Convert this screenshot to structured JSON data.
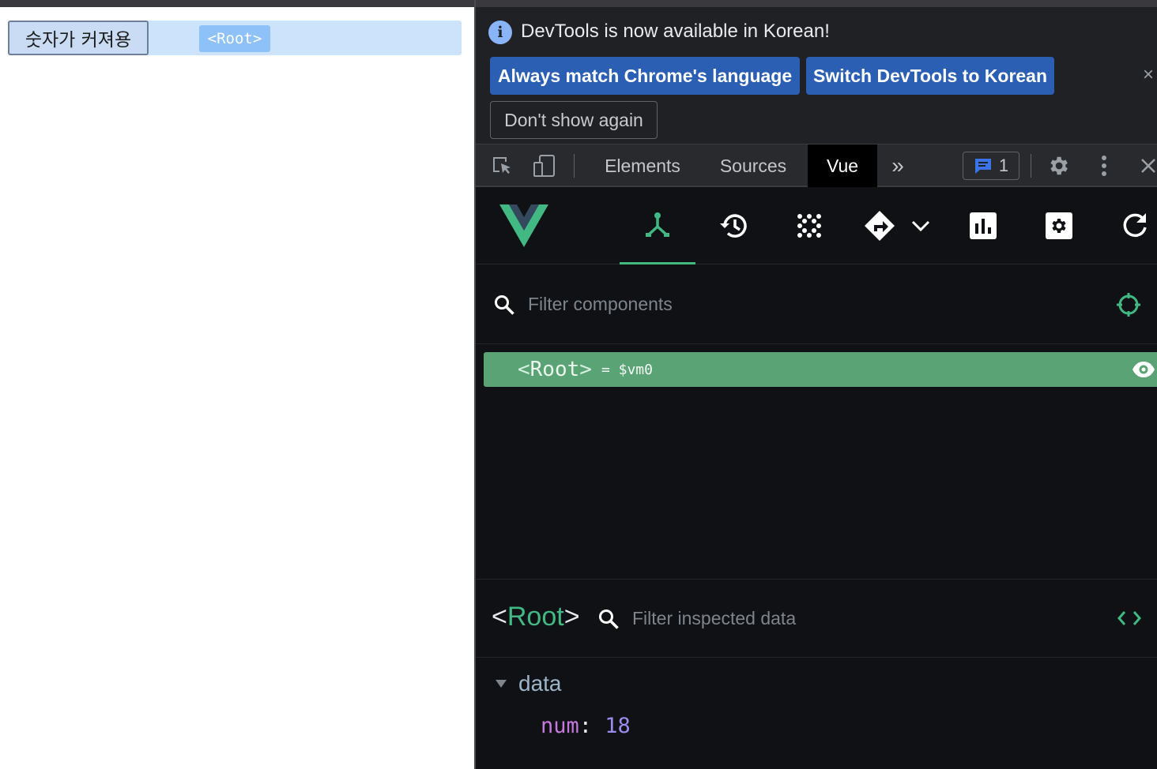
{
  "page": {
    "button_label": "숫자가 커져용",
    "root_tag": "<Root>"
  },
  "infobar": {
    "message": "DevTools is now available in Korean!",
    "always_match": "Always match Chrome's language",
    "switch_label": "Switch DevTools to Korean",
    "dont_show": "Don't show again",
    "close": "×"
  },
  "toolbar": {
    "tabs": [
      "Elements",
      "Sources",
      "Vue"
    ],
    "active_tab": "Vue",
    "more": "»",
    "issues_count": "1"
  },
  "vue": {
    "nav": [
      "components-icon",
      "timeline-icon",
      "plugins-icon",
      "routes-icon",
      "performance-icon",
      "settings-icon",
      "refresh-icon"
    ],
    "filter_placeholder": "Filter components",
    "tree": {
      "open": "<",
      "name": "Root",
      "close": ">",
      "instance": "= $vm0"
    },
    "inspector": {
      "open": "<",
      "name": "Root",
      "close": ">",
      "filter_placeholder": "Filter inspected data",
      "section": "data",
      "fields": [
        {
          "key": "num",
          "value": "18"
        }
      ]
    }
  },
  "colors": {
    "vue_green": "#42b883",
    "selected_row": "#5aa375",
    "primary_button": "#2b5fb3"
  }
}
